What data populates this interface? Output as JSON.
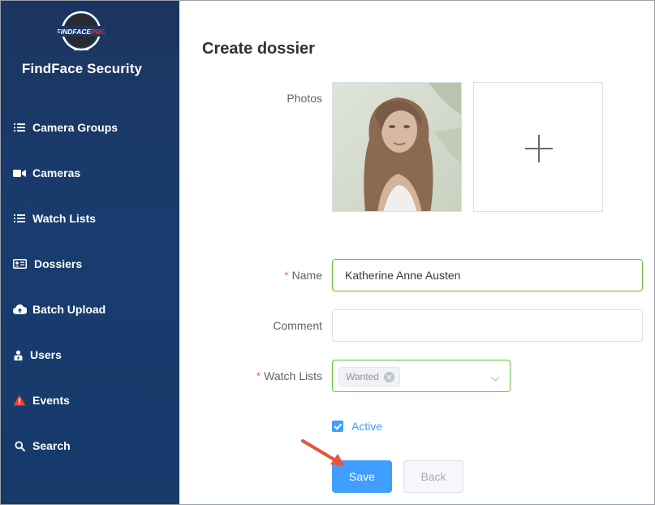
{
  "app": {
    "logo_text": "FINDFACEPRO",
    "brand": "FindFace Security"
  },
  "sidebar": {
    "items": [
      {
        "label": "Camera Groups",
        "icon": "list-icon"
      },
      {
        "label": "Cameras",
        "icon": "video-camera-icon"
      },
      {
        "label": "Watch Lists",
        "icon": "list-icon"
      },
      {
        "label": "Dossiers",
        "icon": "id-card-icon"
      },
      {
        "label": "Batch Upload",
        "icon": "cloud-upload-icon"
      },
      {
        "label": "Users",
        "icon": "users-icon"
      },
      {
        "label": "Events",
        "icon": "warning-icon"
      },
      {
        "label": "Search",
        "icon": "search-icon"
      }
    ]
  },
  "form": {
    "title": "Create dossier",
    "photos_label": "Photos",
    "name_label": "Name",
    "name_value": "Katherine Anne Austen",
    "comment_label": "Comment",
    "comment_value": "",
    "watch_lists_label": "Watch Lists",
    "watch_list_tags": [
      "Wanted"
    ],
    "active_label": "Active",
    "active_checked": true,
    "save_label": "Save",
    "back_label": "Back"
  },
  "colors": {
    "sidebar_bg": "#173a6b",
    "primary": "#409eff",
    "valid_border": "#67c23a",
    "required": "#f56c6c",
    "warning_icon": "#f04134",
    "annotation_arrow": "#e8553a"
  }
}
